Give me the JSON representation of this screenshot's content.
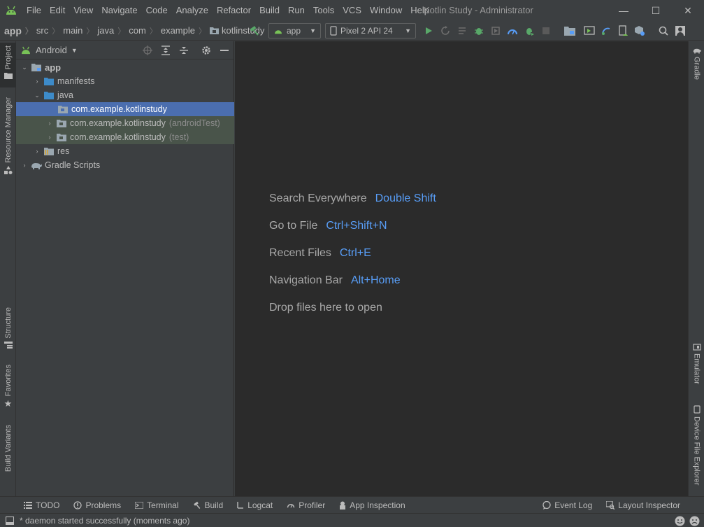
{
  "window": {
    "title": "Kotlin Study - Administrator",
    "minimize_symbol": "—",
    "maximize_symbol": "☐",
    "close_symbol": "✕"
  },
  "menu": [
    "File",
    "Edit",
    "View",
    "Navigate",
    "Code",
    "Analyze",
    "Refactor",
    "Build",
    "Run",
    "Tools",
    "VCS",
    "Window",
    "Help"
  ],
  "breadcrumb": [
    "app",
    "src",
    "main",
    "java",
    "com",
    "example",
    "kotlinstudy"
  ],
  "toolbar": {
    "run_config": "app",
    "device": "Pixel 2 API 24"
  },
  "project_panel": {
    "view_mode": "Android",
    "tree": [
      {
        "label": "app",
        "hint": ""
      },
      {
        "label": "manifests",
        "hint": ""
      },
      {
        "label": "java",
        "hint": ""
      },
      {
        "label": "com.example.kotlinstudy",
        "hint": ""
      },
      {
        "label": "com.example.kotlinstudy",
        "hint": "(androidTest)"
      },
      {
        "label": "com.example.kotlinstudy",
        "hint": "(test)"
      },
      {
        "label": "res",
        "hint": ""
      },
      {
        "label": "Gradle Scripts",
        "hint": ""
      }
    ]
  },
  "left_tabs": {
    "project": "Project",
    "resource_manager": "Resource Manager",
    "structure": "Structure",
    "favorites": "Favorites",
    "build_variants": "Build Variants"
  },
  "right_tabs": {
    "gradle": "Gradle",
    "emulator": "Emulator",
    "device_file_explorer": "Device File Explorer"
  },
  "editor_hints": [
    {
      "text": "Search Everywhere",
      "key": "Double Shift"
    },
    {
      "text": "Go to File",
      "key": "Ctrl+Shift+N"
    },
    {
      "text": "Recent Files",
      "key": "Ctrl+E"
    },
    {
      "text": "Navigation Bar",
      "key": "Alt+Home"
    },
    {
      "text": "Drop files here to open",
      "key": ""
    }
  ],
  "bottom_tabs": {
    "todo": "TODO",
    "problems": "Problems",
    "terminal": "Terminal",
    "build": "Build",
    "logcat": "Logcat",
    "profiler": "Profiler",
    "app_inspection": "App Inspection",
    "event_log": "Event Log",
    "layout_inspector": "Layout Inspector"
  },
  "status": {
    "message": "* daemon started successfully (moments ago)"
  },
  "colors": {
    "android_green": "#78c257",
    "folder_blue": "#3d8bc9",
    "accent_blue": "#589df6",
    "selection": "#4b6eaf",
    "test_row": "#49544a",
    "run_green": "#59a869"
  }
}
